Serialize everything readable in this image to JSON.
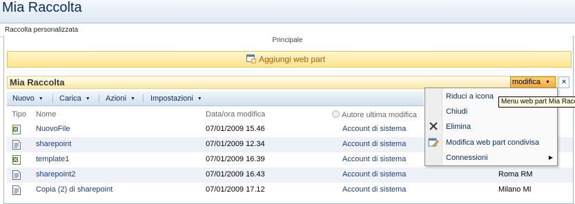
{
  "page": {
    "title": "Mia Raccolta",
    "description": "Raccolta personalizzata",
    "zone_label": "Principale",
    "add_web_part": "Aggiungi web part"
  },
  "webpart": {
    "title": "Mia Raccolta",
    "menu_button": "modifica",
    "close_symbol": "×"
  },
  "toolbar": {
    "items": [
      "Nuovo",
      "Carica",
      "Azioni",
      "Impostazioni"
    ]
  },
  "columns": {
    "type": "Tipo",
    "name": "Nome",
    "modified": "Data/ora modifica",
    "author": "Autore ultima modifica"
  },
  "rows": [
    {
      "icon": "excel-file-icon",
      "name": "NuovoFile",
      "modified": "07/01/2009 15.46",
      "author": "Account di sistema",
      "location": ""
    },
    {
      "icon": "document-icon",
      "name": "sharepoint",
      "modified": "07/01/2009 12.34",
      "author": "Account di sistema",
      "location": ""
    },
    {
      "icon": "excel-file-icon",
      "name": "template1",
      "modified": "07/01/2009 16.39",
      "author": "Account di sistema",
      "location": ""
    },
    {
      "icon": "document-icon",
      "name": "sharepoint2",
      "modified": "07/01/2009 16.43",
      "author": "Account di sistema",
      "location": "Roma RM"
    },
    {
      "icon": "document-icon",
      "name": "Copia (2) di sharepoint",
      "modified": "07/01/2009 17.12",
      "author": "Account di sistema",
      "location": "Milano MI"
    }
  ],
  "context_menu": {
    "items": [
      "Riduci a icona",
      "Chiudi",
      "Elimina",
      "Modifica web part condivisa",
      "Connessioni"
    ]
  },
  "tooltip": "Menu web part Mia Raccolta",
  "colors": {
    "link": "#1b3c83",
    "menu_button": "#f7a836",
    "add_bar": "#fde48d"
  }
}
